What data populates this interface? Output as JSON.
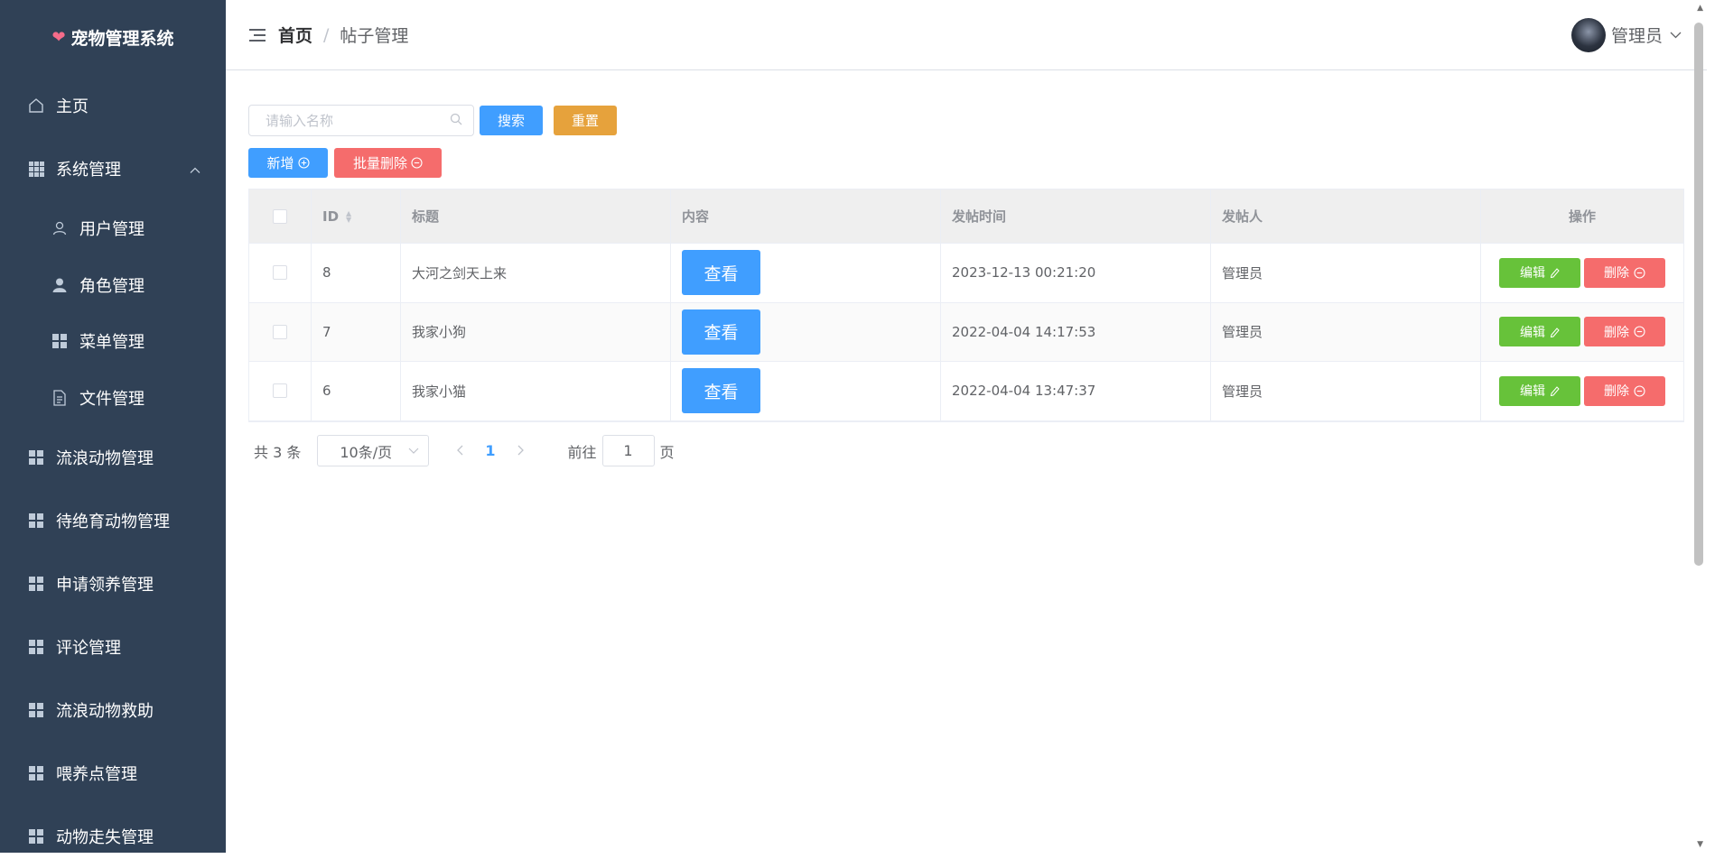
{
  "app": {
    "title": "宠物管理系统"
  },
  "sidebar": {
    "items": [
      {
        "label": "主页",
        "icon": "home-icon"
      },
      {
        "label": "系统管理",
        "icon": "grid-icon",
        "expanded": true
      },
      {
        "label": "用户管理",
        "icon": "user-icon"
      },
      {
        "label": "角色管理",
        "icon": "user-solid-icon"
      },
      {
        "label": "菜单管理",
        "icon": "menu-icon"
      },
      {
        "label": "文件管理",
        "icon": "document-icon"
      },
      {
        "label": "流浪动物管理",
        "icon": "menu-icon"
      },
      {
        "label": "待绝育动物管理",
        "icon": "menu-icon"
      },
      {
        "label": "申请领养管理",
        "icon": "menu-icon"
      },
      {
        "label": "评论管理",
        "icon": "menu-icon"
      },
      {
        "label": "流浪动物救助",
        "icon": "menu-icon"
      },
      {
        "label": "喂养点管理",
        "icon": "menu-icon"
      },
      {
        "label": "动物走失管理",
        "icon": "menu-icon"
      }
    ]
  },
  "header": {
    "breadcrumb": {
      "home": "首页",
      "separator": "/",
      "current": "帖子管理"
    },
    "user": {
      "name": "管理员"
    }
  },
  "toolbar": {
    "search_placeholder": "请输入名称",
    "search_label": "搜索",
    "reset_label": "重置",
    "add_label": "新增",
    "batch_delete_label": "批量删除"
  },
  "table": {
    "columns": [
      "ID",
      "标题",
      "内容",
      "发帖时间",
      "发帖人",
      "操作"
    ],
    "view_label": "查看",
    "edit_label": "编辑",
    "delete_label": "删除",
    "rows": [
      {
        "id": "8",
        "title": "大河之剑天上来",
        "time": "2023-12-13 00:21:20",
        "user": "管理员"
      },
      {
        "id": "7",
        "title": "我家小狗",
        "time": "2022-04-04 14:17:53",
        "user": "管理员"
      },
      {
        "id": "6",
        "title": "我家小猫",
        "time": "2022-04-04 13:47:37",
        "user": "管理员"
      }
    ]
  },
  "pagination": {
    "total_text": "共 3 条",
    "page_size": "10条/页",
    "current_page": "1",
    "goto_label": "前往",
    "goto_value": "1",
    "page_suffix": "页"
  },
  "colors": {
    "sidebar_bg": "#304156",
    "primary": "#409eff",
    "warning": "#e6a23c",
    "danger": "#f56c6c",
    "success": "#67c23a"
  }
}
